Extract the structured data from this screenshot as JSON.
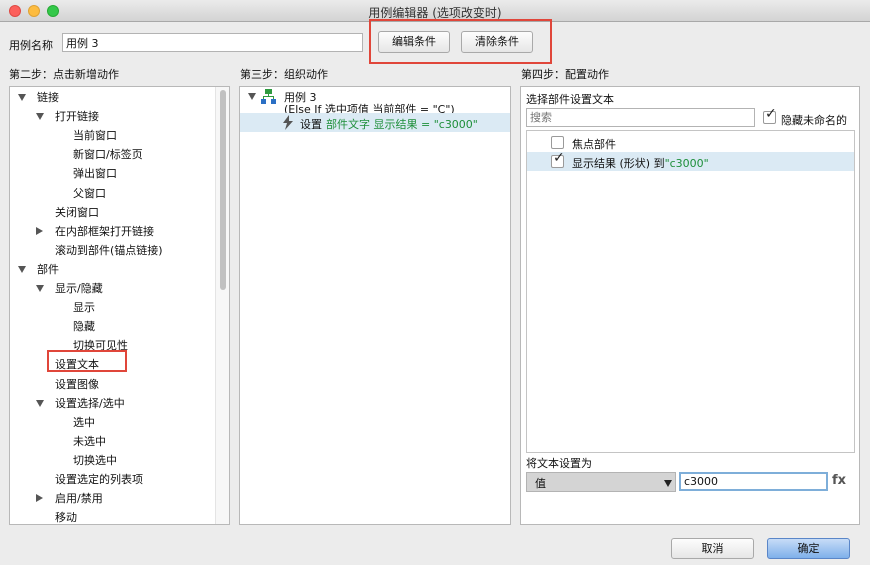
{
  "window": {
    "title": "用例编辑器 (选项改变时)"
  },
  "case_name": {
    "label": "用例名称",
    "value": "用例 3"
  },
  "buttons": {
    "edit_condition": "编辑条件",
    "clear_condition": "清除条件",
    "cancel": "取消",
    "ok": "确定"
  },
  "step2": {
    "heading": "第二步：点击新增动作",
    "items": [
      {
        "label": "链接",
        "toggle": "down"
      },
      {
        "label": "打开链接",
        "toggle": "down"
      },
      {
        "label": "当前窗口",
        "toggle": ""
      },
      {
        "label": "新窗口/标签页",
        "toggle": ""
      },
      {
        "label": "弹出窗口",
        "toggle": ""
      },
      {
        "label": "父窗口",
        "toggle": ""
      },
      {
        "label": "关闭窗口",
        "toggle": ""
      },
      {
        "label": "在内部框架打开链接",
        "toggle": "right"
      },
      {
        "label": "滚动到部件(锚点链接)",
        "toggle": ""
      },
      {
        "label": "部件",
        "toggle": "down"
      },
      {
        "label": "显示/隐藏",
        "toggle": "down"
      },
      {
        "label": "显示",
        "toggle": ""
      },
      {
        "label": "隐藏",
        "toggle": ""
      },
      {
        "label": "切换可见性",
        "toggle": ""
      },
      {
        "label": "设置文本",
        "toggle": ""
      },
      {
        "label": "设置图像",
        "toggle": ""
      },
      {
        "label": "设置选择/选中",
        "toggle": "down"
      },
      {
        "label": "选中",
        "toggle": ""
      },
      {
        "label": "未选中",
        "toggle": ""
      },
      {
        "label": "切换选中",
        "toggle": ""
      },
      {
        "label": "设置选定的列表项",
        "toggle": ""
      },
      {
        "label": "启用/禁用",
        "toggle": "right"
      },
      {
        "label": "移动",
        "toggle": ""
      }
    ]
  },
  "step3": {
    "heading": "第三步：组织动作",
    "case_title": "用例 3",
    "condition": "(Else If 选中项值 当前部件 = \"C\")",
    "action_prefix": "设置",
    "action_detail": "部件文字 显示结果 = \"c3000\""
  },
  "step4": {
    "heading": "第四步：配置动作",
    "subheading": "选择部件设置文本",
    "search_placeholder": "搜索",
    "hide_unnamed_label": "隐藏未命名的",
    "hide_unnamed_checked": true,
    "widgets": [
      {
        "label": "焦点部件",
        "checked": false,
        "value": ""
      },
      {
        "label": "显示结果 (形状) 到",
        "checked": true,
        "value": "\"c3000\""
      }
    ],
    "set_text_label": "将文本设置为",
    "set_type_value": "值",
    "text_value": "c3000",
    "fx_label": "fx"
  }
}
